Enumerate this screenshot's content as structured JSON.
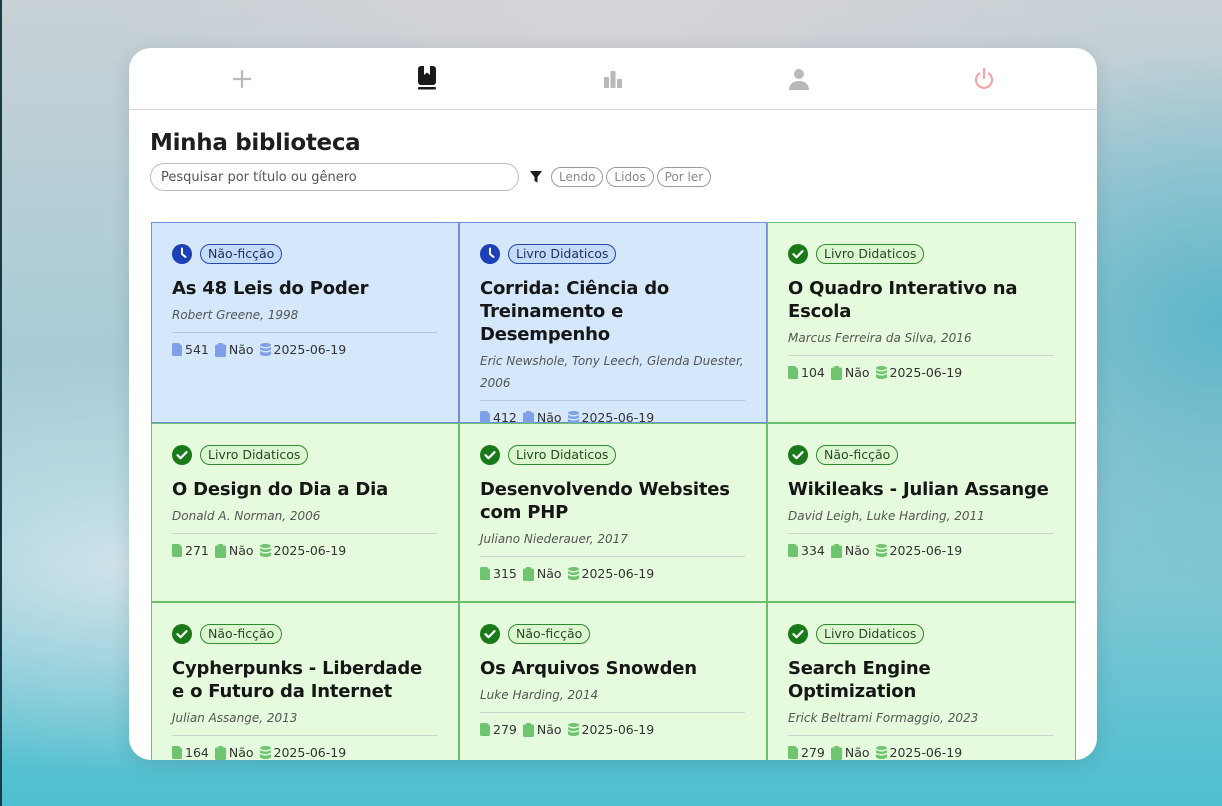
{
  "page": {
    "title": "Minha biblioteca",
    "search_placeholder": "Pesquisar por título ou gênero",
    "filters": [
      "Lendo",
      "Lidos",
      "Por ler"
    ]
  },
  "nav": {
    "items": [
      {
        "icon": "plus-icon",
        "color": "#b8b8b8"
      },
      {
        "icon": "bookmark-book-icon",
        "color": "#1a1a1a",
        "active": true
      },
      {
        "icon": "bar-chart-icon",
        "color": "#b8b8b8"
      },
      {
        "icon": "user-icon",
        "color": "#b8b8b8"
      },
      {
        "icon": "power-icon",
        "color": "#f2a5a5"
      }
    ]
  },
  "colors": {
    "reading_bg": "#d4e7fb",
    "reading_accent": "#1d3fb8",
    "done_bg": "#e6fbdd",
    "done_accent": "#1a7a1a"
  },
  "books": [
    {
      "status": "reading",
      "genre": "Não-ficção",
      "title": "As 48 Leis do Poder",
      "meta": "Robert Greene, 1998",
      "pages": "541",
      "ebook": "Não",
      "date": "2025-06-19"
    },
    {
      "status": "reading",
      "genre": "Livro Didaticos",
      "title": "Corrida: Ciência do Treinamento e Desempenho",
      "meta": "Eric Newshole, Tony Leech, Glenda Duester, 2006",
      "pages": "412",
      "ebook": "Não",
      "date": "2025-06-19"
    },
    {
      "status": "done",
      "genre": "Livro Didaticos",
      "title": "O Quadro Interativo na Escola",
      "meta": "Marcus Ferreira da Silva, 2016",
      "pages": "104",
      "ebook": "Não",
      "date": "2025-06-19"
    },
    {
      "status": "done",
      "genre": "Livro Didaticos",
      "title": "O Design do Dia a Dia",
      "meta": "Donald A. Norman, 2006",
      "pages": "271",
      "ebook": "Não",
      "date": "2025-06-19"
    },
    {
      "status": "done",
      "genre": "Livro Didaticos",
      "title": "Desenvolvendo Websites com PHP",
      "meta": "Juliano Niederauer, 2017",
      "pages": "315",
      "ebook": "Não",
      "date": "2025-06-19"
    },
    {
      "status": "done",
      "genre": "Não-ficção",
      "title": "Wikileaks - Julian Assange",
      "meta": "David Leigh, Luke Harding, 2011",
      "pages": "334",
      "ebook": "Não",
      "date": "2025-06-19"
    },
    {
      "status": "done",
      "genre": "Não-ficção",
      "title": "Cypherpunks - Liberdade e o Futuro da Internet",
      "meta": "Julian Assange, 2013",
      "pages": "164",
      "ebook": "Não",
      "date": "2025-06-19"
    },
    {
      "status": "done",
      "genre": "Não-ficção",
      "title": "Os Arquivos Snowden",
      "meta": "Luke Harding, 2014",
      "pages": "279",
      "ebook": "Não",
      "date": "2025-06-19"
    },
    {
      "status": "done",
      "genre": "Livro Didaticos",
      "title": "Search Engine Optimization",
      "meta": "Erick Beltrami Formaggio, 2023",
      "pages": "279",
      "ebook": "Não",
      "date": "2025-06-19"
    }
  ]
}
